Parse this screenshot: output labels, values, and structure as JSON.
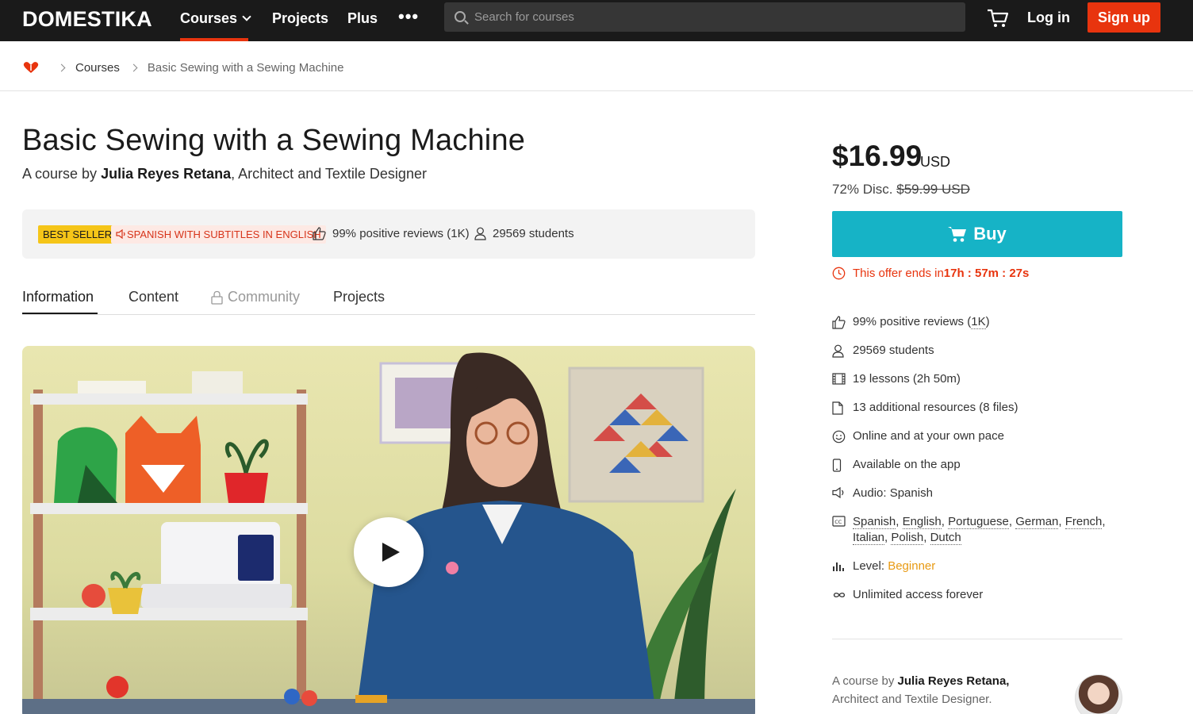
{
  "header": {
    "logo": "DOMESTIKA",
    "nav": {
      "courses": "Courses",
      "projects": "Projects",
      "plus": "Plus",
      "more": "•••"
    },
    "search_placeholder": "Search for courses",
    "login": "Log in",
    "signup": "Sign up"
  },
  "breadcrumb": {
    "item1": "Courses",
    "current": "Basic Sewing with a Sewing Machine"
  },
  "course": {
    "title": "Basic Sewing with a Sewing Machine",
    "by_prefix": "A course by ",
    "author": "Julia Reyes Retana",
    "author_role": ", Architect and Textile Designer",
    "badge_best": "BEST SELLER",
    "badge_lang": "SPANISH WITH SUBTITLES IN ENGLISH",
    "reviews": "99% positive reviews (1K)",
    "students": "29569 students"
  },
  "tabs": {
    "information": "Information",
    "content": "Content",
    "community": "Community",
    "projects": "Projects"
  },
  "sidebar": {
    "price": "$16.99",
    "currency": "USD",
    "discount_prefix": "72% Disc. ",
    "old_price": "$59.99 USD",
    "buy": "Buy",
    "offer_prefix": "This offer ends in ",
    "offer_time": "17h : 57m : 27s",
    "features": {
      "reviews_prefix": "99% positive reviews (",
      "reviews_count": "1K",
      "reviews_suffix": ")",
      "students": "29569 students",
      "lessons": "19 lessons (2h 50m)",
      "resources": "13 additional resources (8 files)",
      "pace": "Online and at your own pace",
      "app": "Available on the app",
      "audio": "Audio: Spanish",
      "subtitles": [
        "Spanish",
        "English",
        "Portuguese",
        "German",
        "French",
        "Italian",
        "Polish",
        "Dutch"
      ],
      "level_prefix": "Level: ",
      "level": "Beginner",
      "access": "Unlimited access forever"
    },
    "author_prefix": "A course by ",
    "author_name": "Julia Reyes Retana,",
    "author_role": "Architect and Textile Designer."
  },
  "colors": {
    "brand": "#e8340e",
    "buy": "#16b3c6",
    "best_seller": "#f5c518",
    "level": "#e89a13"
  }
}
